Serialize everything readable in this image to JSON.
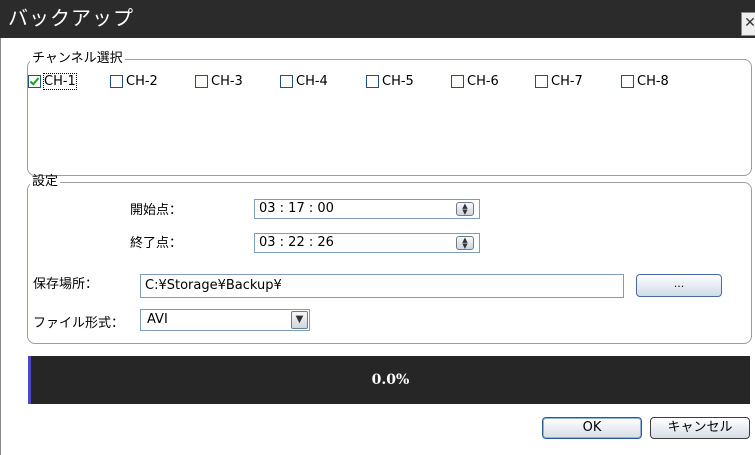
{
  "window": {
    "title": "バックアップ",
    "close_label": "✕"
  },
  "channel_selection": {
    "legend": "チャンネル選択",
    "channels": [
      {
        "label": "CH-1",
        "checked": true
      },
      {
        "label": "CH-2",
        "checked": false
      },
      {
        "label": "CH-3",
        "checked": false
      },
      {
        "label": "CH-4",
        "checked": false
      },
      {
        "label": "CH-5",
        "checked": false
      },
      {
        "label": "CH-6",
        "checked": false
      },
      {
        "label": "CH-7",
        "checked": false
      },
      {
        "label": "CH-8",
        "checked": false
      }
    ]
  },
  "settings": {
    "legend": "設定",
    "start_label": "開始点：",
    "start_value": "03 : 17 : 00",
    "end_label": "終了点：",
    "end_value": "03 : 22 : 26",
    "save_location_label": "保存場所：",
    "save_location_value": "C:¥Storage¥Backup¥",
    "browse_label": "...",
    "file_format_label": "ファイル形式：",
    "file_format_value": "AVI"
  },
  "progress": {
    "text": "0.0%",
    "fraction": 0.0,
    "accent": "#4b49c8"
  },
  "buttons": {
    "ok": "OK",
    "cancel": "キャンセル"
  }
}
